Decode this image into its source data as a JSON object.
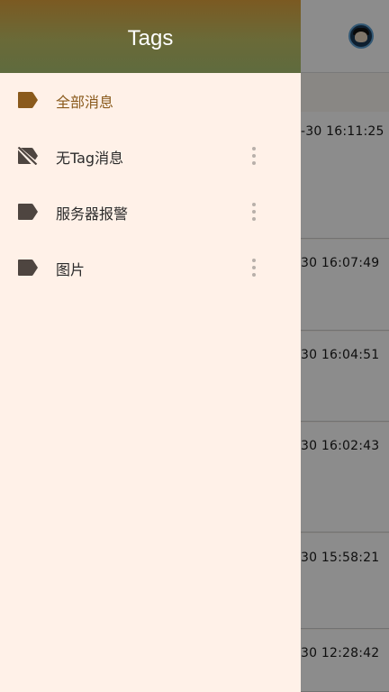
{
  "drawer": {
    "title": "Tags",
    "items": [
      {
        "label": "全部消息",
        "icon": "label-icon",
        "selected": true,
        "has_menu": false
      },
      {
        "label": "无Tag消息",
        "icon": "label-off-icon",
        "selected": false,
        "has_menu": true
      },
      {
        "label": "服务器报警",
        "icon": "label-icon",
        "selected": false,
        "has_menu": true
      },
      {
        "label": "图片",
        "icon": "label-icon",
        "selected": false,
        "has_menu": true
      }
    ]
  },
  "background": {
    "messages": [
      {
        "time": "-30 16:11:25"
      },
      {
        "time": "30 16:07:49"
      },
      {
        "time": "30 16:04:51"
      },
      {
        "time": "30 16:02:43"
      },
      {
        "time": "30 15:58:21"
      },
      {
        "time": "30 12:28:42"
      }
    ]
  },
  "colors": {
    "accent": "#8a5a1c",
    "drawer_bg": "#fff1e8",
    "icon": "#4e4540"
  }
}
